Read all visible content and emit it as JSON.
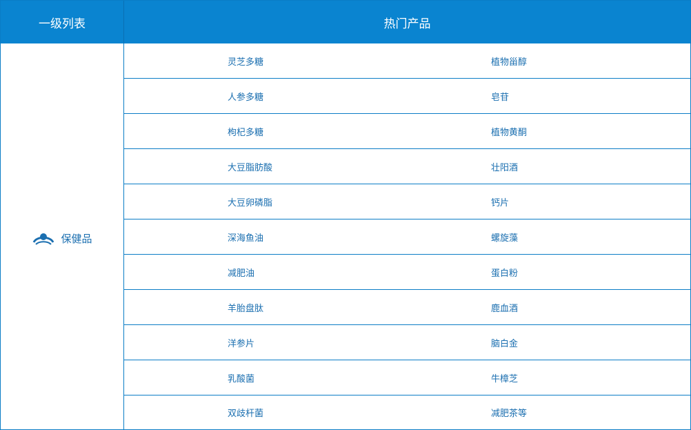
{
  "header": {
    "col1": "一级列表",
    "col2": "热门产品"
  },
  "category": {
    "icon": "category-logo-icon",
    "label": "保健品"
  },
  "products": [
    [
      "灵芝多糖",
      "植物甾醇"
    ],
    [
      "人参多糖",
      "皂苷"
    ],
    [
      "枸杞多糖",
      "植物黄酮"
    ],
    [
      "大豆脂肪酸",
      "壮阳酒"
    ],
    [
      "大豆卵磷脂",
      "钙片"
    ],
    [
      "深海鱼油",
      "螺旋藻"
    ],
    [
      "减肥油",
      "蛋白粉"
    ],
    [
      "羊胎盘肽",
      "鹿血酒"
    ],
    [
      "洋参片",
      "脑白金"
    ],
    [
      "乳酸菌",
      "牛樟芝"
    ],
    [
      "双歧杆菌",
      "减肥茶等"
    ]
  ],
  "colors": {
    "header_bg": "#0a84d0",
    "border": "#0a7cc6",
    "text": "#1b6fb0"
  }
}
